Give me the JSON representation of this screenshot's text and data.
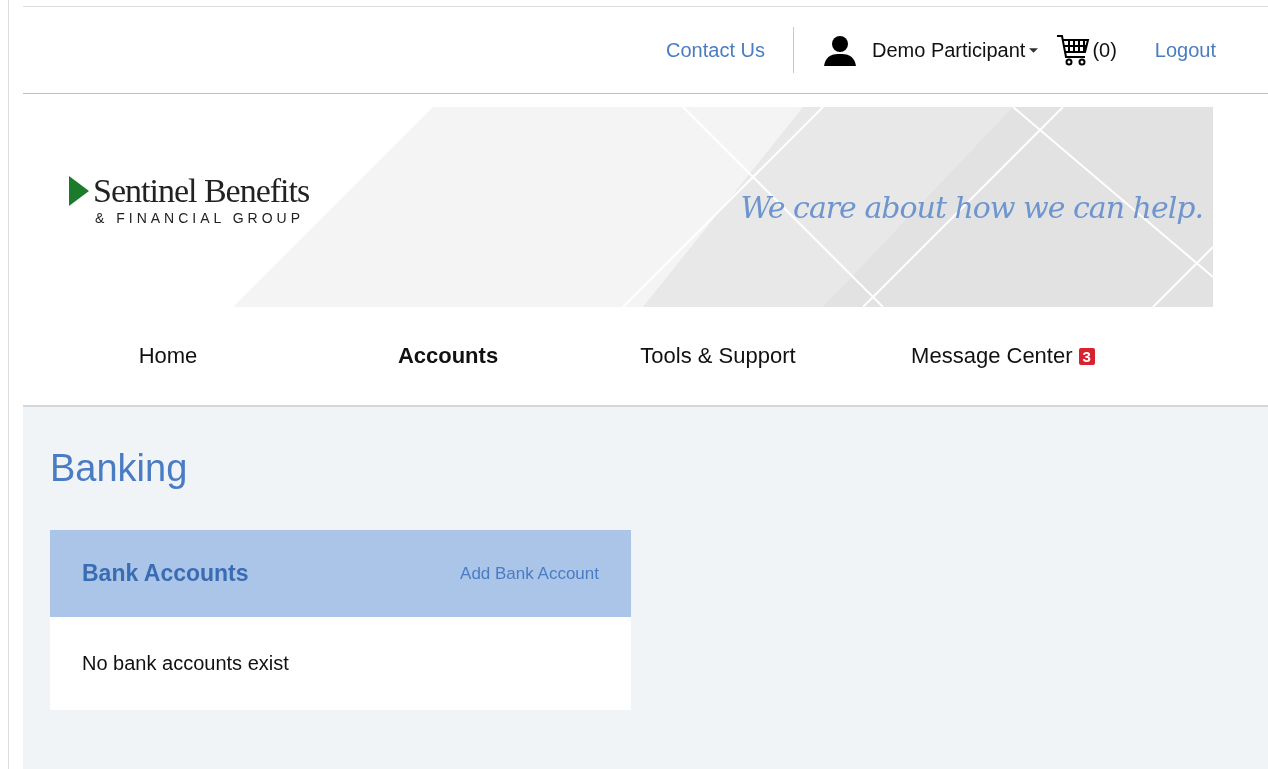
{
  "top_bar": {
    "contact": "Contact Us",
    "user": "Demo Participant",
    "cart": "(0)",
    "logout": "Logout"
  },
  "banner": {
    "logo_name": "Sentinel Benefits",
    "logo_sub": "& FINANCIAL GROUP",
    "tagline": "We care about how we can help."
  },
  "nav": [
    {
      "label": "Home",
      "selected": false
    },
    {
      "label": "Accounts",
      "selected": true
    },
    {
      "label": "Tools & Support",
      "selected": false
    },
    {
      "label": "Message Center",
      "selected": false,
      "badge": "3"
    }
  ],
  "page_title": "Banking",
  "panel": {
    "title": "Bank Accounts",
    "action": "Add Bank Account",
    "empty": "No bank accounts exist"
  }
}
